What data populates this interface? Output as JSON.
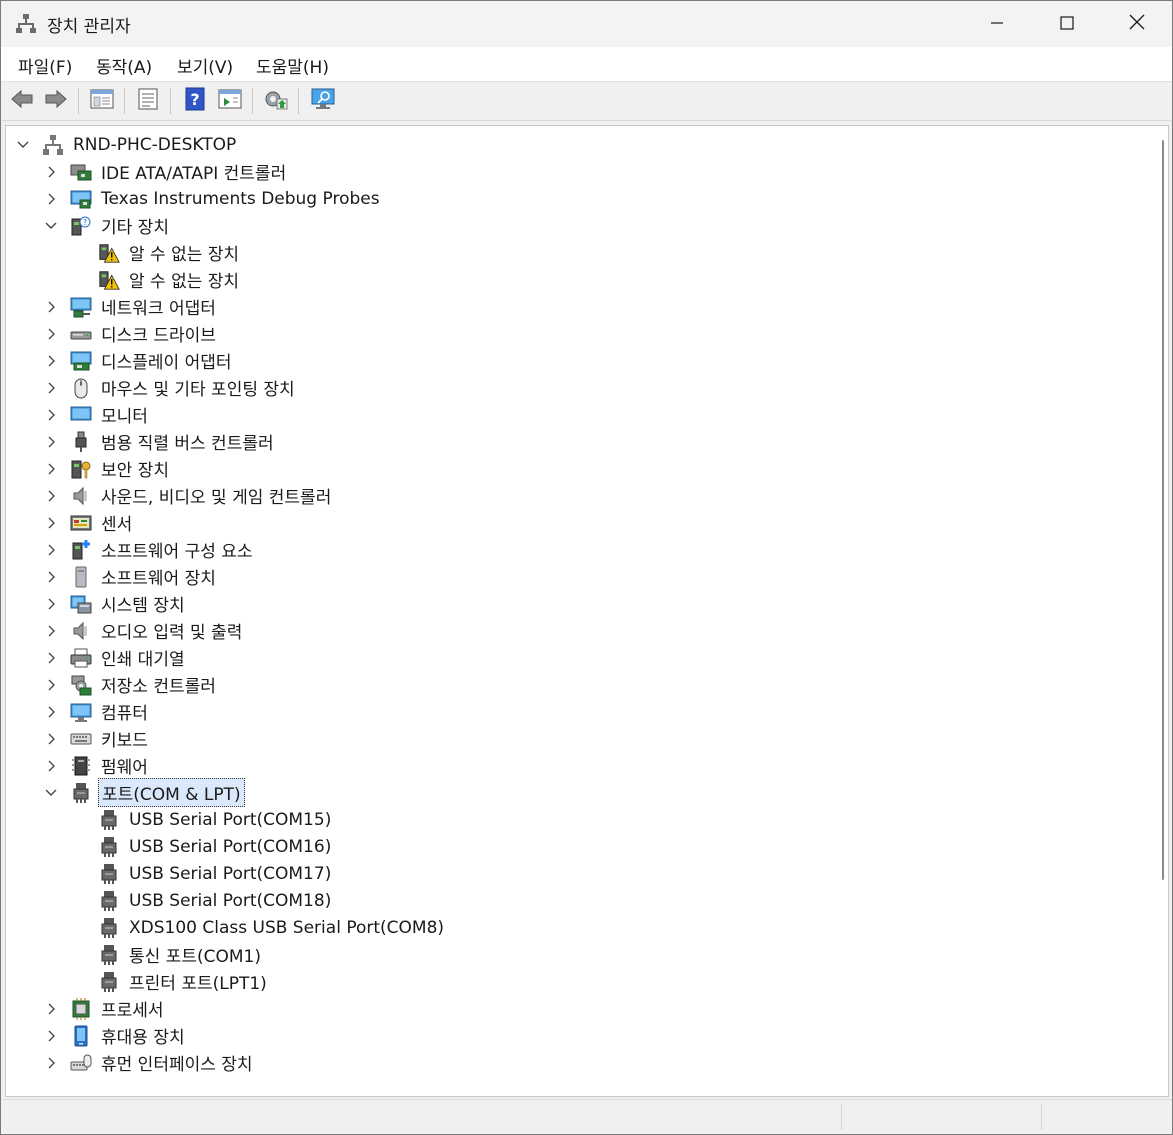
{
  "window": {
    "title": "장치 관리자"
  },
  "menu": [
    {
      "label": "파일(F)"
    },
    {
      "label": "동작(A)"
    },
    {
      "label": "보기(V)"
    },
    {
      "label": "도움말(H)"
    }
  ],
  "colors": {
    "accent": "#2d7ff9",
    "selection": "#d9e8fb",
    "warning": "#f5c400"
  },
  "tree": {
    "root": {
      "label": "RND-PHC-DESKTOP",
      "icon": "computer-network-icon"
    },
    "categories": [
      {
        "label": "IDE ATA/ATAPI 컨트롤러",
        "icon": "ide-controller-icon",
        "expanded": false
      },
      {
        "label": "Texas Instruments Debug Probes",
        "icon": "debug-probe-icon",
        "expanded": false
      },
      {
        "label": "기타 장치",
        "icon": "other-device-icon",
        "expanded": true,
        "children": [
          {
            "label": "알 수 없는 장치",
            "icon": "unknown-device-warning-icon"
          },
          {
            "label": "알 수 없는 장치",
            "icon": "unknown-device-warning-icon"
          }
        ]
      },
      {
        "label": "네트워크 어댑터",
        "icon": "network-adapter-icon",
        "expanded": false
      },
      {
        "label": "디스크 드라이브",
        "icon": "disk-drive-icon",
        "expanded": false
      },
      {
        "label": "디스플레이 어댑터",
        "icon": "display-adapter-icon",
        "expanded": false
      },
      {
        "label": "마우스 및 기타 포인팅 장치",
        "icon": "mouse-icon",
        "expanded": false
      },
      {
        "label": "모니터",
        "icon": "monitor-icon",
        "expanded": false
      },
      {
        "label": "범용 직렬 버스 컨트롤러",
        "icon": "usb-icon",
        "expanded": false
      },
      {
        "label": "보안 장치",
        "icon": "security-key-icon",
        "expanded": false
      },
      {
        "label": "사운드, 비디오 및 게임 컨트롤러",
        "icon": "speaker-icon",
        "expanded": false
      },
      {
        "label": "센서",
        "icon": "sensor-icon",
        "expanded": false
      },
      {
        "label": "소프트웨어 구성 요소",
        "icon": "software-component-icon",
        "expanded": false
      },
      {
        "label": "소프트웨어 장치",
        "icon": "software-device-icon",
        "expanded": false
      },
      {
        "label": "시스템 장치",
        "icon": "system-device-icon",
        "expanded": false
      },
      {
        "label": "오디오 입력 및 출력",
        "icon": "speaker-icon",
        "expanded": false
      },
      {
        "label": "인쇄 대기열",
        "icon": "printer-icon",
        "expanded": false
      },
      {
        "label": "저장소 컨트롤러",
        "icon": "storage-controller-icon",
        "expanded": false
      },
      {
        "label": "컴퓨터",
        "icon": "computer-icon",
        "expanded": false
      },
      {
        "label": "키보드",
        "icon": "keyboard-icon",
        "expanded": false
      },
      {
        "label": "펌웨어",
        "icon": "firmware-icon",
        "expanded": false
      },
      {
        "label": "포트(COM & LPT)",
        "icon": "port-icon",
        "expanded": true,
        "selected": true,
        "children": [
          {
            "label": "USB Serial Port(COM15)",
            "icon": "port-icon"
          },
          {
            "label": "USB Serial Port(COM16)",
            "icon": "port-icon"
          },
          {
            "label": "USB Serial Port(COM17)",
            "icon": "port-icon"
          },
          {
            "label": "USB Serial Port(COM18)",
            "icon": "port-icon"
          },
          {
            "label": "XDS100 Class USB Serial Port(COM8)",
            "icon": "port-icon"
          },
          {
            "label": "통신 포트(COM1)",
            "icon": "port-icon"
          },
          {
            "label": "프린터 포트(LPT1)",
            "icon": "port-icon"
          }
        ]
      },
      {
        "label": "프로세서",
        "icon": "processor-icon",
        "expanded": false
      },
      {
        "label": "휴대용 장치",
        "icon": "portable-device-icon",
        "expanded": false
      },
      {
        "label": "휴먼 인터페이스 장치",
        "icon": "hid-icon",
        "expanded": false
      }
    ]
  }
}
